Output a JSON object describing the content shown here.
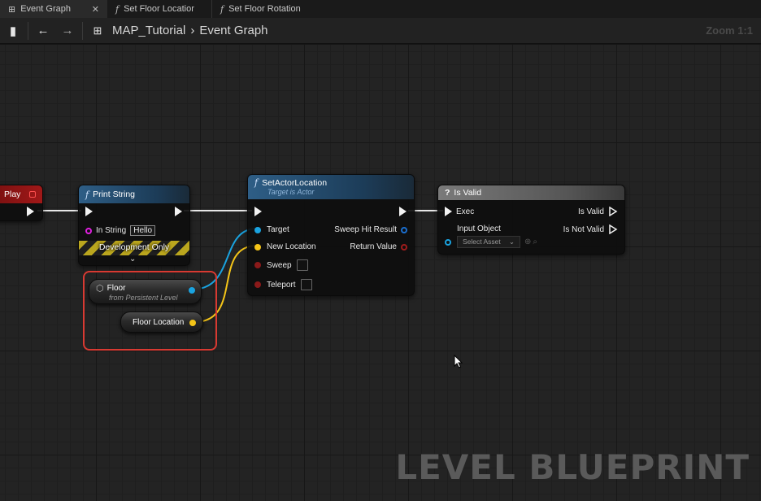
{
  "tabs": [
    {
      "label": "Event Graph",
      "icon": "graph-icon",
      "active": true
    },
    {
      "label": "Set Floor Locatior",
      "icon": "function-icon"
    },
    {
      "label": "Set Floor Rotation",
      "icon": "function-icon"
    }
  ],
  "toolbar": {
    "breadcrumb": [
      "MAP_Tutorial",
      "Event Graph"
    ],
    "zoom": "Zoom 1:1"
  },
  "nodes": {
    "begin_play": {
      "title": "Play"
    },
    "print_string": {
      "title": "Print String",
      "in_string_label": "In String",
      "in_string_value": "Hello",
      "dev_only": "Development Only"
    },
    "set_actor_location": {
      "title": "SetActorLocation",
      "subtitle": "Target is Actor",
      "inputs": [
        "Target",
        "New Location",
        "Sweep",
        "Teleport"
      ],
      "outputs": [
        "Sweep Hit Result",
        "Return Value"
      ]
    },
    "is_valid": {
      "title": "Is Valid",
      "exec_label": "Exec",
      "input_label": "Input Object",
      "select_placeholder": "Select Asset",
      "outputs": [
        "Is Valid",
        "Is Not Valid"
      ]
    },
    "floor": {
      "title": "Floor",
      "subtitle": "from Persistent Level"
    },
    "floor_location": {
      "title": "Floor Location"
    }
  },
  "watermark": "LEVEL BLUEPRINT",
  "colors": {
    "exec": "#f2f2f2",
    "object_pin": "#1aa3e0",
    "vector_pin": "#f5c518",
    "bool_pin": "#8b1a1a",
    "string_pin": "#e020e0",
    "highlight": "#d83a32"
  }
}
